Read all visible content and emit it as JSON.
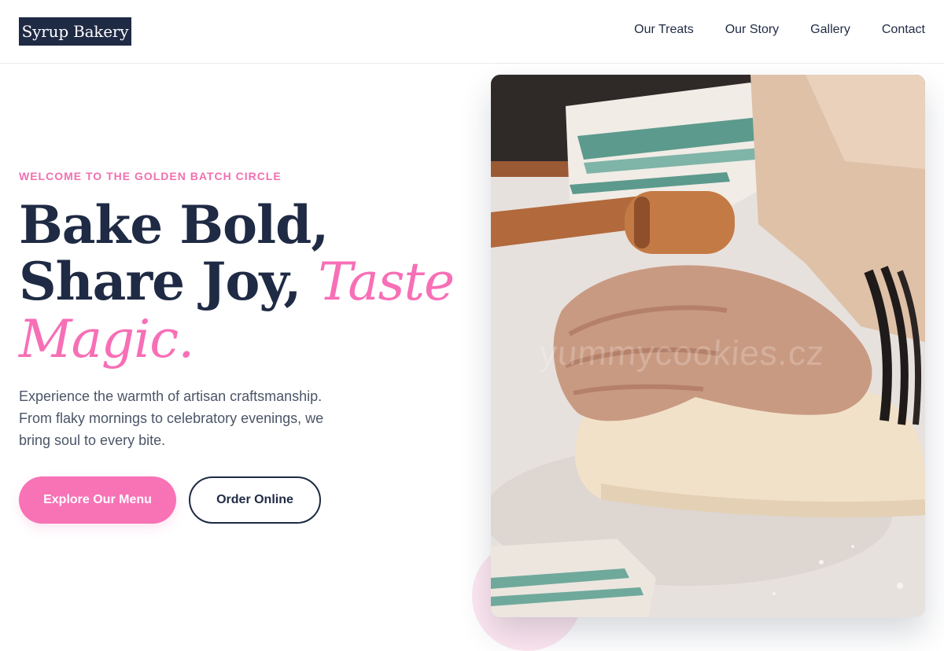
{
  "brand": {
    "name": "Syrup Bakery"
  },
  "nav": {
    "items": [
      {
        "label": "Our Treats"
      },
      {
        "label": "Our Story"
      },
      {
        "label": "Gallery"
      },
      {
        "label": "Contact"
      }
    ]
  },
  "hero": {
    "eyebrow": "WELCOME TO THE GOLDEN BATCH CIRCLE",
    "headline": {
      "line1": "Bake Bold,",
      "line2": "Share Joy,",
      "accent1": "Taste",
      "accent2": "Magic."
    },
    "description": "Experience the warmth of artisan craftsmanship. From flaky mornings to celebratory evenings, we bring soul to every bite.",
    "primary_cta": "Explore Our Menu",
    "secondary_cta": "Order Online",
    "image": {
      "subject": "hands kneading dough on a floured surface",
      "watermark": "yummycookies.cz"
    }
  },
  "colors": {
    "navy": "#1f2a44",
    "pink": "#f872b6",
    "text_muted": "#4b5568"
  }
}
